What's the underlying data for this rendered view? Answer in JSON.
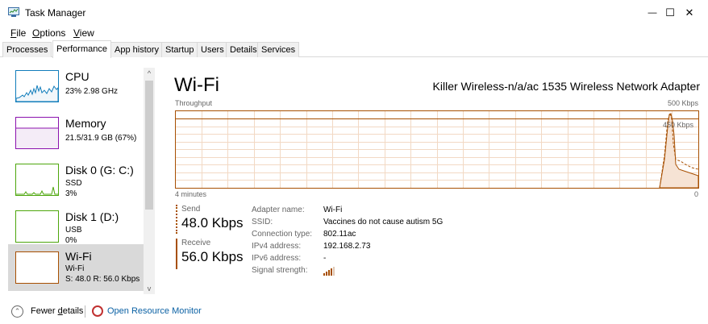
{
  "window": {
    "title": "Task Manager",
    "minimize_glyph": "—",
    "maximize_glyph": "☐",
    "close_glyph": "✕"
  },
  "menu": [
    {
      "label": "File",
      "underline": "F",
      "rest": "ile"
    },
    {
      "label": "Options",
      "underline": "O",
      "rest": "ptions"
    },
    {
      "label": "View",
      "underline": "V",
      "rest": "iew"
    }
  ],
  "tabs": [
    "Processes",
    "Performance",
    "App history",
    "Startup",
    "Users",
    "Details",
    "Services"
  ],
  "active_tab": "Performance",
  "sidebar": {
    "items": [
      {
        "name": "CPU",
        "line1": "23% 2.98 GHz",
        "line2": ""
      },
      {
        "name": "Memory",
        "line1": "21.5/31.9 GB (67%)",
        "line2": ""
      },
      {
        "name": "Disk 0 (G: C:)",
        "line1": "SSD",
        "line2": "3%"
      },
      {
        "name": "Disk 1 (D:)",
        "line1": "USB",
        "line2": "0%"
      },
      {
        "name": "Wi-Fi",
        "line1": "Wi-Fi",
        "line2": "S: 48.0 R: 56.0 Kbps"
      }
    ],
    "scroll_up_glyph": "^",
    "scroll_down_glyph": "v"
  },
  "main": {
    "title": "Wi-Fi",
    "adapter": "Killer Wireless-n/a/ac 1535 Wireless Network Adapter",
    "throughput_label": "Throughput",
    "scale_max": "500 Kbps",
    "scale_marker": "450 Kbps",
    "time_span": "4 minutes",
    "scale_min": "0",
    "send_label": "Send",
    "send_value": "48.0 Kbps",
    "receive_label": "Receive",
    "receive_value": "56.0 Kbps",
    "info": [
      {
        "key": "Adapter name:",
        "value": "Wi-Fi"
      },
      {
        "key": "SSID:",
        "value": "Vaccines do not cause autism 5G"
      },
      {
        "key": "Connection type:",
        "value": "802.11ac"
      },
      {
        "key": "IPv4 address:",
        "value": "192.168.2.73"
      },
      {
        "key": "IPv6 address:",
        "value": "-"
      },
      {
        "key": "Signal strength:",
        "value": ""
      }
    ],
    "signal_bars": 4
  },
  "footer": {
    "fewer_details_pre": "Fewer ",
    "fewer_details_u": "d",
    "fewer_details_post": "etails",
    "open_resource_monitor": "Open Resource Monitor"
  },
  "colors": {
    "accent": "#a74f01",
    "cpu": "#117dbb",
    "memory": "#8b12ae",
    "disk": "#4da60c",
    "wifi": "#a74f01",
    "link": "#0b61a4"
  }
}
